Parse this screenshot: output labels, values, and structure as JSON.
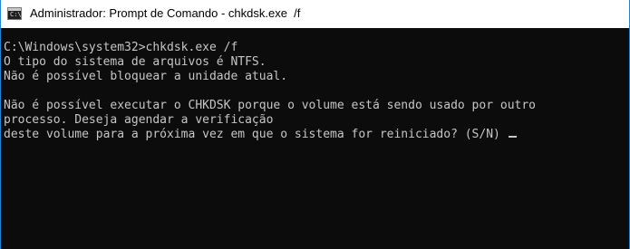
{
  "window": {
    "title": "Administrador: Prompt de Comando - chkdsk.exe  /f",
    "icon": "cmd-icon",
    "icon_glyph": "C:\\"
  },
  "console": {
    "lines": [
      "C:\\Windows\\system32>chkdsk.exe /f",
      "O tipo do sistema de arquivos é NTFS.",
      "Não é possível bloquear a unidade atual.",
      "",
      "Não é possível executar o CHKDSK porque o volume está sendo usado por outro",
      "processo. Deseja agendar a verificação",
      "deste volume para a próxima vez em que o sistema for reiniciado? (S/N) "
    ],
    "background": "#0c0c0c",
    "foreground": "#c6c6c6"
  }
}
